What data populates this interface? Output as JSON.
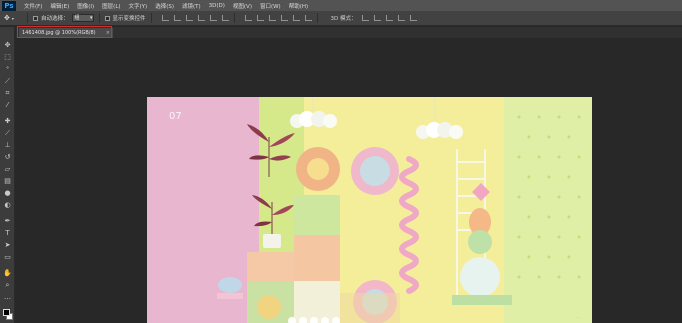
{
  "app": {
    "logo": "Ps"
  },
  "menu": [
    "文件(F)",
    "编辑(E)",
    "图像(I)",
    "图层(L)",
    "文字(Y)",
    "选择(S)",
    "滤镜(T)",
    "3D(D)",
    "视图(V)",
    "窗口(W)",
    "帮助(H)"
  ],
  "options": {
    "auto_select_label": "自动选择：",
    "auto_select_value": "组",
    "show_transform_label": "显示变换控件",
    "mode_3d_label": "3D 模式："
  },
  "document": {
    "tab_title": "1461408.jpg @ 100%(RGB/8)",
    "tab_close": "×"
  },
  "artwork": {
    "corner_text": "07"
  },
  "watermark": "...",
  "colors": {
    "accent": "#d62c2c",
    "menubar": "#535353",
    "optbar": "#424242",
    "workspace": "#282828"
  }
}
